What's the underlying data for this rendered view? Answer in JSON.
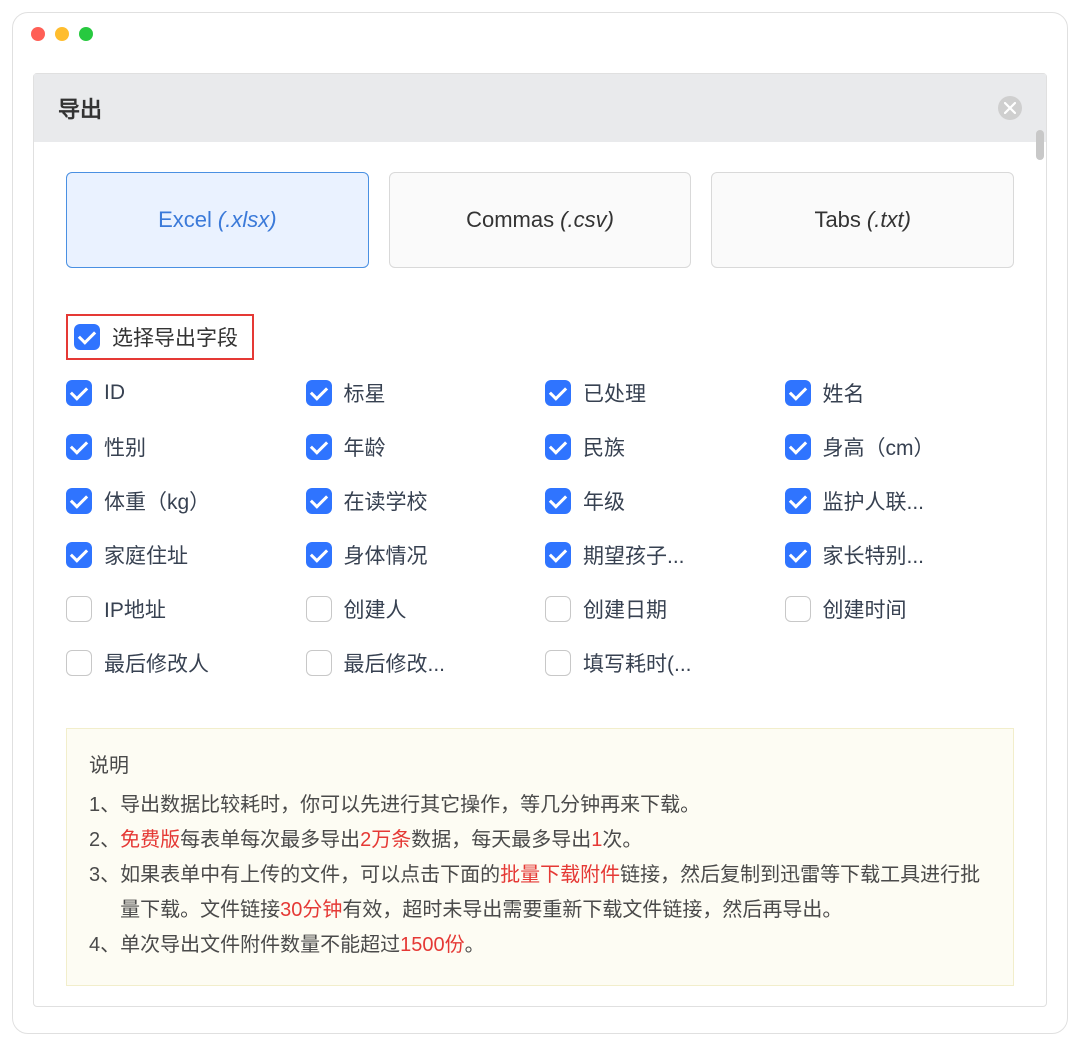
{
  "dialog": {
    "title": "导出"
  },
  "tabs": [
    {
      "name": "Excel",
      "ext": "(.xlsx)",
      "active": true
    },
    {
      "name": "Commas",
      "ext": "(.csv)",
      "active": false
    },
    {
      "name": "Tabs",
      "ext": "(.txt)",
      "active": false
    }
  ],
  "selectAll": {
    "label": "选择导出字段",
    "checked": true
  },
  "fields": [
    {
      "label": "ID",
      "checked": true
    },
    {
      "label": "标星",
      "checked": true
    },
    {
      "label": "已处理",
      "checked": true
    },
    {
      "label": "姓名",
      "checked": true
    },
    {
      "label": "性别",
      "checked": true
    },
    {
      "label": "年龄",
      "checked": true
    },
    {
      "label": "民族",
      "checked": true
    },
    {
      "label": "身高（cm）",
      "checked": true
    },
    {
      "label": "体重（kg）",
      "checked": true
    },
    {
      "label": "在读学校",
      "checked": true
    },
    {
      "label": "年级",
      "checked": true
    },
    {
      "label": "监护人联...",
      "checked": true
    },
    {
      "label": "家庭住址",
      "checked": true
    },
    {
      "label": "身体情况",
      "checked": true
    },
    {
      "label": "期望孩子...",
      "checked": true
    },
    {
      "label": "家长特别...",
      "checked": true
    },
    {
      "label": "IP地址",
      "checked": false
    },
    {
      "label": "创建人",
      "checked": false
    },
    {
      "label": "创建日期",
      "checked": false
    },
    {
      "label": "创建时间",
      "checked": false
    },
    {
      "label": "最后修改人",
      "checked": false
    },
    {
      "label": "最后修改...",
      "checked": false
    },
    {
      "label": "填写耗时(...",
      "checked": false
    }
  ],
  "notes": {
    "title": "说明",
    "items": [
      {
        "idx": "1、",
        "segments": [
          {
            "text": "导出数据比较耗时，你可以先进行其它操作，等几分钟再来下载。"
          }
        ]
      },
      {
        "idx": "2、",
        "segments": [
          {
            "text": "免费版",
            "hl": true
          },
          {
            "text": "每表单每次最多导出"
          },
          {
            "text": "2万条",
            "hl": true
          },
          {
            "text": "数据，每天最多导出"
          },
          {
            "text": "1",
            "hl": true
          },
          {
            "text": "次。"
          }
        ]
      },
      {
        "idx": "3、",
        "segments": [
          {
            "text": "如果表单中有上传的文件，可以点击下面的"
          },
          {
            "text": "批量下载附件",
            "hl": true
          },
          {
            "text": "链接，然后复制到迅雷等下载工具进行批量下载。文件链接"
          },
          {
            "text": "30分钟",
            "hl": true
          },
          {
            "text": "有效，超时未导出需要重新下载文件链接，然后再导出。"
          }
        ]
      },
      {
        "idx": "4、",
        "segments": [
          {
            "text": "单次导出文件附件数量不能超过"
          },
          {
            "text": "1500份",
            "hl": true
          },
          {
            "text": "。"
          }
        ]
      }
    ]
  }
}
